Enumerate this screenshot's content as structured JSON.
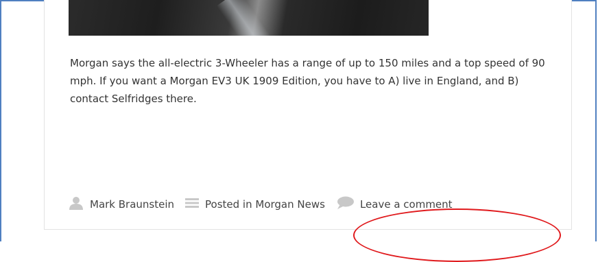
{
  "article": {
    "body": "Morgan says the all-electric 3-Wheeler has a range of up to 150 miles and a top speed of 90 mph. If you want a Morgan EV3 UK 1909 Edition, you have to A) live in England, and B) contact Selfridges there."
  },
  "meta": {
    "author": "Mark Braunstein",
    "posted_in_prefix": "Posted in",
    "category": "Morgan News",
    "comment_link": "Leave a comment",
    "icons": {
      "author": "user-icon",
      "category": "menu-lines-icon",
      "comment": "speech-bubble-icon"
    }
  },
  "colors": {
    "frame_border": "#4f7fc0",
    "annotation": "#e0191c",
    "icon_gray": "#c8c8c8",
    "text": "#333333"
  }
}
